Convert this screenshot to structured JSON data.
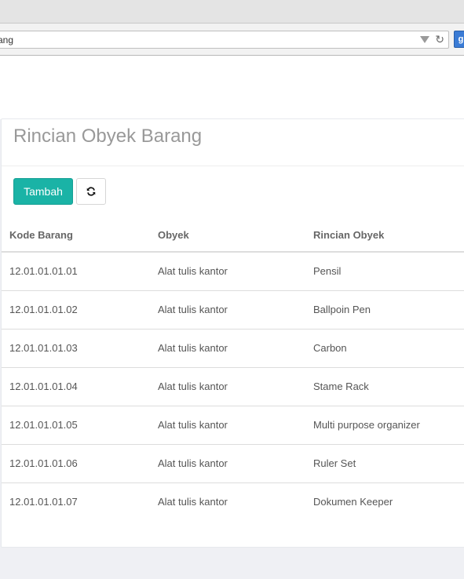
{
  "browser": {
    "address_text": "ang",
    "extension_label": "g"
  },
  "panel": {
    "title": "Rincian Obyek Barang",
    "add_button_label": "Tambah",
    "refresh_icon": "refresh-icon"
  },
  "table": {
    "columns": [
      "Kode Barang",
      "Obyek",
      "Rincian Obyek"
    ],
    "rows": [
      [
        "12.01.01.01.01",
        "Alat tulis kantor",
        "Pensil"
      ],
      [
        "12.01.01.01.02",
        "Alat tulis kantor",
        "Ballpoin Pen"
      ],
      [
        "12.01.01.01.03",
        "Alat tulis kantor",
        "Carbon"
      ],
      [
        "12.01.01.01.04",
        "Alat tulis kantor",
        "Stame Rack"
      ],
      [
        "12.01.01.01.05",
        "Alat tulis kantor",
        "Multi purpose organizer"
      ],
      [
        "12.01.01.01.06",
        "Alat tulis kantor",
        "Ruler Set"
      ],
      [
        "12.01.01.01.07",
        "Alat tulis kantor",
        "Dokumen Keeper"
      ]
    ]
  },
  "colors": {
    "accent": "#1ab3a6",
    "background": "#eff0f4"
  }
}
